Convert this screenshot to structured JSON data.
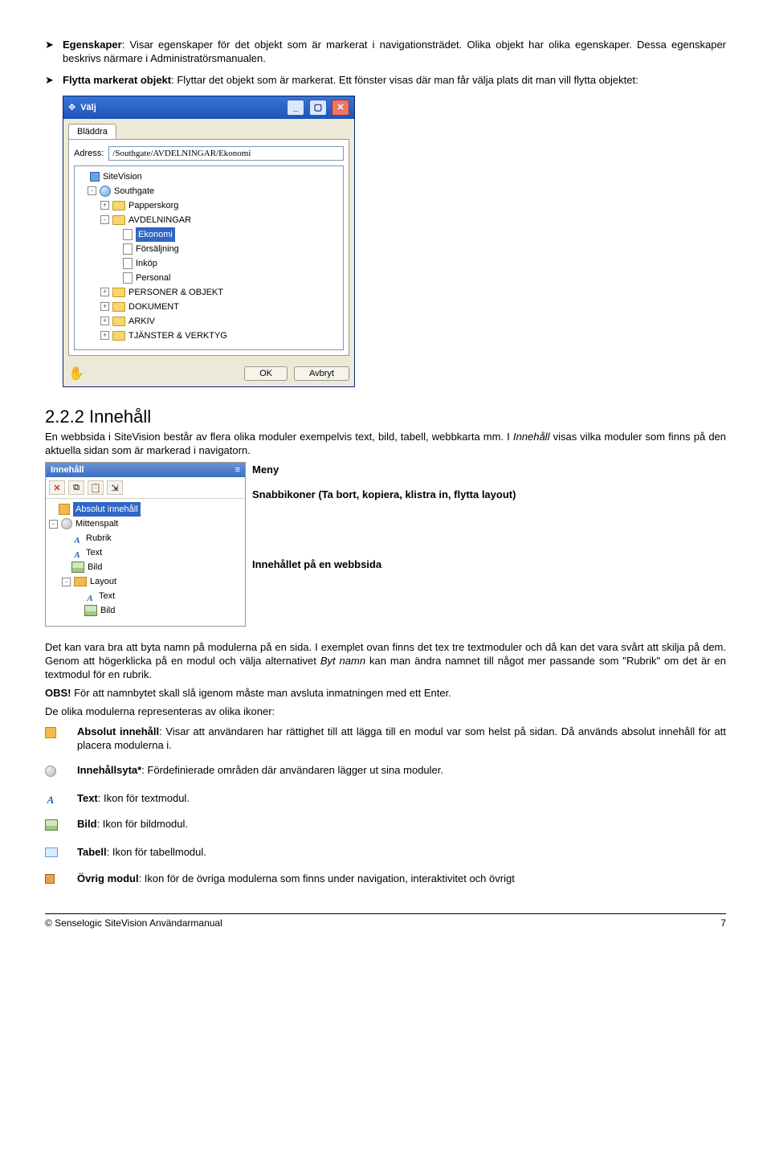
{
  "bullets": {
    "b1_bold": "Egenskaper",
    "b1_rest": ": Visar egenskaper för det objekt som är markerat i navigationsträdet. Olika objekt har olika egenskaper. Dessa egenskaper beskrivs närmare i Administratörsmanualen.",
    "b2_bold": "Flytta markerat objekt",
    "b2_rest": ": Flyttar det objekt som är markerat. Ett fönster visas där man får välja plats dit man vill flytta objektet:"
  },
  "valj": {
    "title": "Välj",
    "tab": "Bläddra",
    "address_label": "Adress:",
    "address_value": "/Southgate/AVDELNINGAR/Ekonomi",
    "ok": "OK",
    "cancel": "Avbryt",
    "tree": {
      "root": "SiteVision",
      "southgate": "Southgate",
      "papperskorg": "Papperskorg",
      "avdelningar": "AVDELNINGAR",
      "ekonomi": "Ekonomi",
      "forsaljning": "Försäljning",
      "inkop": "Inköp",
      "personal": "Personal",
      "personer": "PERSONER & OBJEKT",
      "dokument": "DOKUMENT",
      "arkiv": "ARKIV",
      "tjanster": "TJÄNSTER & VERKTYG"
    }
  },
  "section_heading": "2.2.2 Innehåll",
  "section_intro_a": "En webbsida i SiteVision består av flera olika moduler exempelvis text, bild, tabell, webbkarta mm. I ",
  "section_intro_i": "Innehåll",
  "section_intro_b": " visas vilka moduler som finns på den aktuella sidan som är markerad i navigatorn.",
  "panel": {
    "title": "Innehåll",
    "items": {
      "abs": "Absolut innehåll",
      "mitten": "Mittenspalt",
      "rubrik": "Rubrik",
      "text": "Text",
      "bild": "Bild",
      "layout": "Layout",
      "text2": "Text",
      "bild2": "Bild"
    }
  },
  "callouts": {
    "c1": "Meny",
    "c2": "Snabbikoner (Ta bort, kopiera, klistra in, flytta layout)",
    "c3": "Innehållet på en webbsida"
  },
  "para2_a": "Det kan vara bra att byta namn på modulerna  på en sida. I exemplet ovan finns det tex tre textmoduler och då kan det vara svårt att skilja på dem. Genom att högerklicka på en modul och välja alternativet  ",
  "para2_i": "Byt namn",
  "para2_b": " kan man ändra namnet till något mer passande som \"Rubrik\" om det är en textmodul för en rubrik.",
  "obs": "OBS!",
  "obs_rest": " För att namnbytet skall slå igenom måste man avsluta inmatningen med ett Enter.",
  "icons_intro": "De olika modulerna representeras av olika ikoner:",
  "legend": {
    "abs_b": "Absolut innehåll",
    "abs_r": ": Visar att användaren har rättighet till att lägga till en modul var som helst på sidan. Då används absolut innehåll för att placera modulerna i.",
    "yta_b": "Innehållsyta*",
    "yta_r": ": Fördefinierade områden där användaren lägger ut sina moduler.",
    "text_b": "Text",
    "text_r": ": Ikon för textmodul.",
    "bild_b": "Bild",
    "bild_r": ": Ikon för bildmodul.",
    "tab_b": "Tabell",
    "tab_r": ": Ikon för tabellmodul.",
    "ovr_b": "Övrig modul",
    "ovr_r": ": Ikon för de övriga modulerna som finns under navigation, interaktivitet och övrigt"
  },
  "footer_left": "© Senselogic SiteVision Användarmanual",
  "footer_right": "7"
}
